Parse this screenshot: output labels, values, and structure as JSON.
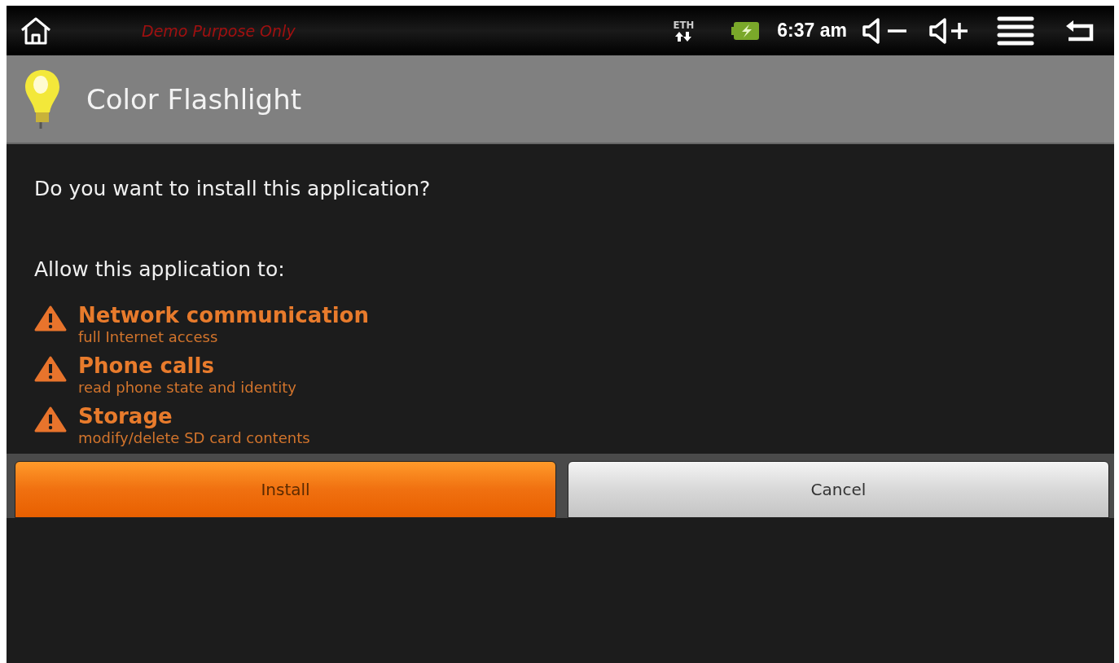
{
  "status_bar": {
    "label": "Demo Purpose Only",
    "network": "ETH",
    "time": "6:37 am"
  },
  "dialog": {
    "title": "Color Flashlight",
    "question": "Do you want to install this application?",
    "allow_heading": "Allow this application to:",
    "permissions": [
      {
        "title": "Network communication",
        "detail": "full Internet access"
      },
      {
        "title": "Phone calls",
        "detail": "read phone state and identity"
      },
      {
        "title": "Storage",
        "detail": "modify/delete SD card contents"
      }
    ],
    "buttons": [
      {
        "label": "Install",
        "kind": "primary"
      },
      {
        "label": "Cancel",
        "kind": "secondary"
      }
    ]
  }
}
